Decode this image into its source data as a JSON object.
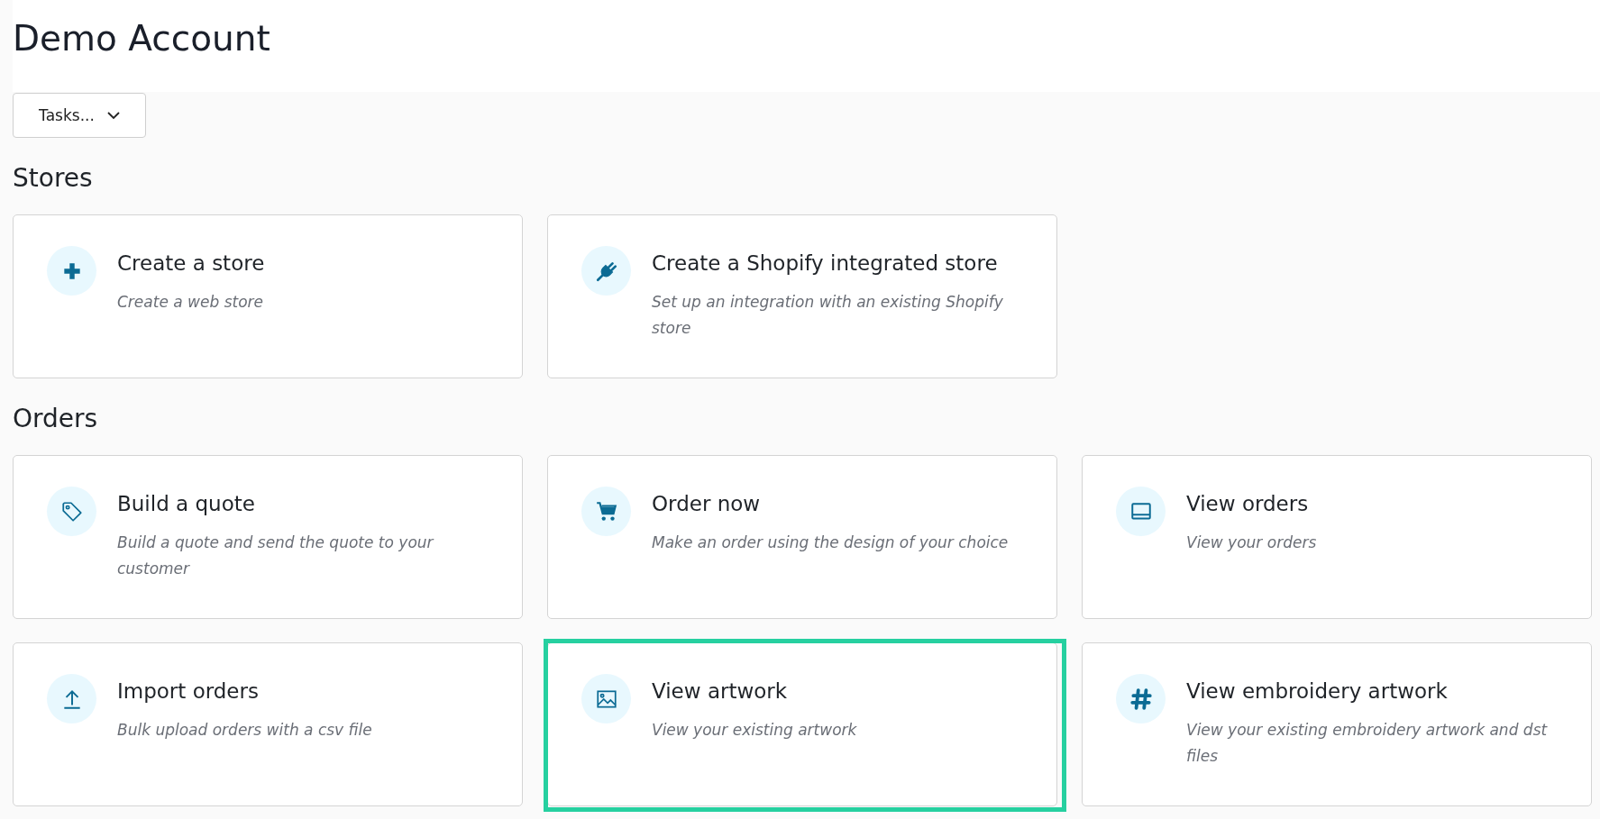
{
  "header": {
    "title": "Demo Account"
  },
  "tasks_button": {
    "label": "Tasks..."
  },
  "sections": [
    {
      "title": "Stores",
      "cards": [
        {
          "kind": "plus",
          "title": "Create a store",
          "description": "Create a web store",
          "highlighted": false
        },
        {
          "kind": "plug",
          "title": "Create a Shopify integrated store",
          "description": "Set up an integration with an existing Shopify store",
          "highlighted": false
        }
      ]
    },
    {
      "title": "Orders",
      "cards": [
        {
          "kind": "tag",
          "title": "Build a quote",
          "description": "Build a quote and send the quote to your customer",
          "highlighted": false
        },
        {
          "kind": "cart",
          "title": "Order now",
          "description": "Make an order using the design of your choice",
          "highlighted": false
        },
        {
          "kind": "monitor",
          "title": "View orders",
          "description": "View your orders",
          "highlighted": false
        },
        {
          "kind": "upload",
          "title": "Import orders",
          "description": "Bulk upload orders with a csv file",
          "highlighted": false
        },
        {
          "kind": "image",
          "title": "View artwork",
          "description": "View your existing artwork",
          "highlighted": true
        },
        {
          "kind": "hash",
          "title": "View embroidery artwork",
          "description": "View your existing embroidery artwork and dst files",
          "highlighted": false
        }
      ]
    }
  ]
}
